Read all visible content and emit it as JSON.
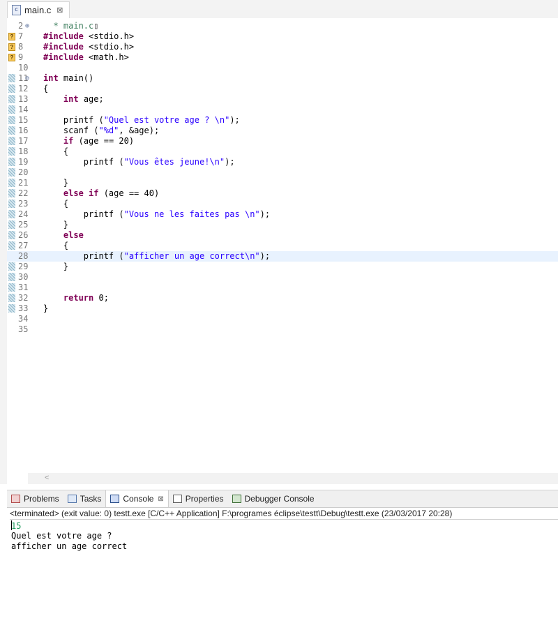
{
  "editor": {
    "tab_icon": "c-file-icon",
    "tab_label": "main.c",
    "tab_close": "⊠",
    "lines": [
      {
        "no": "2",
        "fold": "⊕",
        "segments": [
          {
            "t": "  * main.c",
            "c": "cm"
          }
        ],
        "caret": true
      },
      {
        "no": "7",
        "warn": true,
        "segments": [
          {
            "t": "#include ",
            "c": "kw"
          },
          {
            "t": "<stdio.h>",
            "c": ""
          }
        ]
      },
      {
        "no": "8",
        "warn": true,
        "segments": [
          {
            "t": "#include ",
            "c": "kw"
          },
          {
            "t": "<stdio.h>",
            "c": ""
          }
        ]
      },
      {
        "no": "9",
        "warn": true,
        "segments": [
          {
            "t": "#include ",
            "c": "kw"
          },
          {
            "t": "<math.h>",
            "c": ""
          }
        ]
      },
      {
        "no": "10",
        "segments": []
      },
      {
        "no": "11",
        "fold": "⊖",
        "segments": [
          {
            "t": "int ",
            "c": "kw"
          },
          {
            "t": "main()",
            "c": ""
          }
        ]
      },
      {
        "no": "12",
        "segments": [
          {
            "t": "{",
            "c": ""
          }
        ]
      },
      {
        "no": "13",
        "segments": [
          {
            "t": "    ",
            "c": ""
          },
          {
            "t": "int ",
            "c": "kw"
          },
          {
            "t": "age;",
            "c": ""
          }
        ]
      },
      {
        "no": "14",
        "segments": []
      },
      {
        "no": "15",
        "segments": [
          {
            "t": "    printf (",
            "c": ""
          },
          {
            "t": "\"Quel est votre age ? \\n\"",
            "c": "str"
          },
          {
            "t": ");",
            "c": ""
          }
        ]
      },
      {
        "no": "16",
        "segments": [
          {
            "t": "    scanf (",
            "c": ""
          },
          {
            "t": "\"%d\"",
            "c": "str"
          },
          {
            "t": ", &age);",
            "c": ""
          }
        ]
      },
      {
        "no": "17",
        "segments": [
          {
            "t": "    ",
            "c": ""
          },
          {
            "t": "if ",
            "c": "kw"
          },
          {
            "t": "(age == 20)",
            "c": ""
          }
        ]
      },
      {
        "no": "18",
        "segments": [
          {
            "t": "    {",
            "c": ""
          }
        ]
      },
      {
        "no": "19",
        "segments": [
          {
            "t": "        printf (",
            "c": ""
          },
          {
            "t": "\"Vous êtes jeune!\\n\"",
            "c": "str"
          },
          {
            "t": ");",
            "c": ""
          }
        ]
      },
      {
        "no": "20",
        "segments": []
      },
      {
        "no": "21",
        "segments": [
          {
            "t": "    }",
            "c": ""
          }
        ]
      },
      {
        "no": "22",
        "segments": [
          {
            "t": "    ",
            "c": ""
          },
          {
            "t": "else if ",
            "c": "kw"
          },
          {
            "t": "(age == 40)",
            "c": ""
          }
        ]
      },
      {
        "no": "23",
        "segments": [
          {
            "t": "    {",
            "c": ""
          }
        ]
      },
      {
        "no": "24",
        "segments": [
          {
            "t": "        printf (",
            "c": ""
          },
          {
            "t": "\"Vous ne les faites pas \\n\"",
            "c": "str"
          },
          {
            "t": ");",
            "c": ""
          }
        ]
      },
      {
        "no": "25",
        "segments": [
          {
            "t": "    }",
            "c": ""
          }
        ]
      },
      {
        "no": "26",
        "segments": [
          {
            "t": "    ",
            "c": ""
          },
          {
            "t": "else",
            "c": "kw"
          }
        ]
      },
      {
        "no": "27",
        "segments": [
          {
            "t": "    {",
            "c": ""
          }
        ]
      },
      {
        "no": "28",
        "highlight": true,
        "segments": [
          {
            "t": "        printf (",
            "c": ""
          },
          {
            "t": "\"afficher un age correct\\n\"",
            "c": "str"
          },
          {
            "t": ");",
            "c": ""
          }
        ]
      },
      {
        "no": "29",
        "segments": [
          {
            "t": "    }",
            "c": ""
          }
        ]
      },
      {
        "no": "30",
        "segments": []
      },
      {
        "no": "31",
        "segments": []
      },
      {
        "no": "32",
        "segments": [
          {
            "t": "    ",
            "c": ""
          },
          {
            "t": "return ",
            "c": "kw"
          },
          {
            "t": "0;",
            "c": ""
          }
        ]
      },
      {
        "no": "33",
        "segments": [
          {
            "t": "}",
            "c": ""
          }
        ]
      },
      {
        "no": "34",
        "segments": []
      },
      {
        "no": "35",
        "segments": []
      }
    ],
    "hscroll_arrow": "<"
  },
  "views": {
    "tabs": [
      {
        "label": "Problems",
        "icon": "problems-icon"
      },
      {
        "label": "Tasks",
        "icon": "tasks-icon"
      },
      {
        "label": "Console",
        "icon": "console-icon",
        "active": true,
        "close": "⊠"
      },
      {
        "label": "Properties",
        "icon": "properties-icon"
      },
      {
        "label": "Debugger Console",
        "icon": "debugger-icon"
      }
    ]
  },
  "console": {
    "status": "<terminated> (exit value: 0) testt.exe [C/C++ Application] F:\\programes éclipse\\testt\\Debug\\testt.exe (23/03/2017 20:28)",
    "input_line": "15",
    "output_lines": [
      "Quel est votre age ?",
      "afficher un age correct"
    ]
  },
  "colors": {
    "keyword": "#7f0055",
    "string": "#2a00ff",
    "comment": "#3f7f5f",
    "console_input": "#1f9a5c",
    "current_line": "#e8f2fe"
  }
}
